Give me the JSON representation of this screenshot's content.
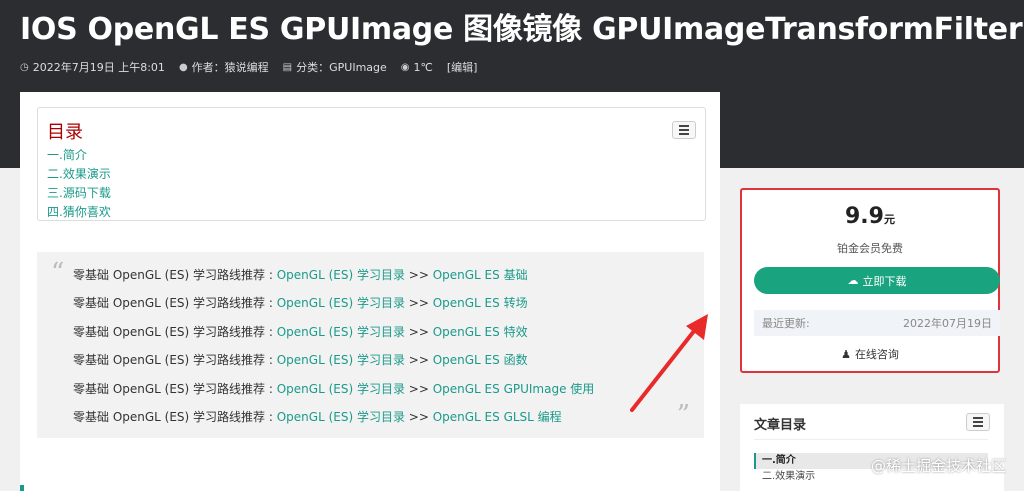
{
  "post": {
    "title": "IOS OpenGL ES GPUImage 图像镜像 GPUImageTransformFilter",
    "meta": {
      "date": "2022年7月19日 上午8:01",
      "author": "作者：猿说编程",
      "category": "分类：GPUImage",
      "views": "1℃",
      "edit": "[编辑]"
    }
  },
  "toc": {
    "title": "目录",
    "items": [
      "一.简介",
      "二.效果演示",
      "三.源码下载",
      "四.猜你喜欢"
    ]
  },
  "quote": {
    "prefix": "零基础 OpenGL (ES) 学习路线推荐 : ",
    "link1": "OpenGL (ES) 学习目录",
    "sep": " >> ",
    "links": [
      "OpenGL ES 基础",
      "OpenGL ES 转场",
      "OpenGL ES 特效",
      "OpenGL ES 函数",
      "OpenGL ES GPUImage 使用",
      "OpenGL ES GLSL 编程"
    ]
  },
  "download": {
    "price": "9.9",
    "unit": "元",
    "free_note": "铂金会员免费",
    "button": "立即下载",
    "updated_label": "最近更新:",
    "updated_value": "2022年07月19日",
    "consult": "在线咨询"
  },
  "article_toc": {
    "title": "文章目录",
    "items": [
      "一.简介",
      "二.效果演示"
    ]
  },
  "watermark": "@稀土掘金技术社区",
  "colors": {
    "accent": "#1aa37f",
    "link": "#1a9a8a",
    "highlight": "#e0323a"
  }
}
